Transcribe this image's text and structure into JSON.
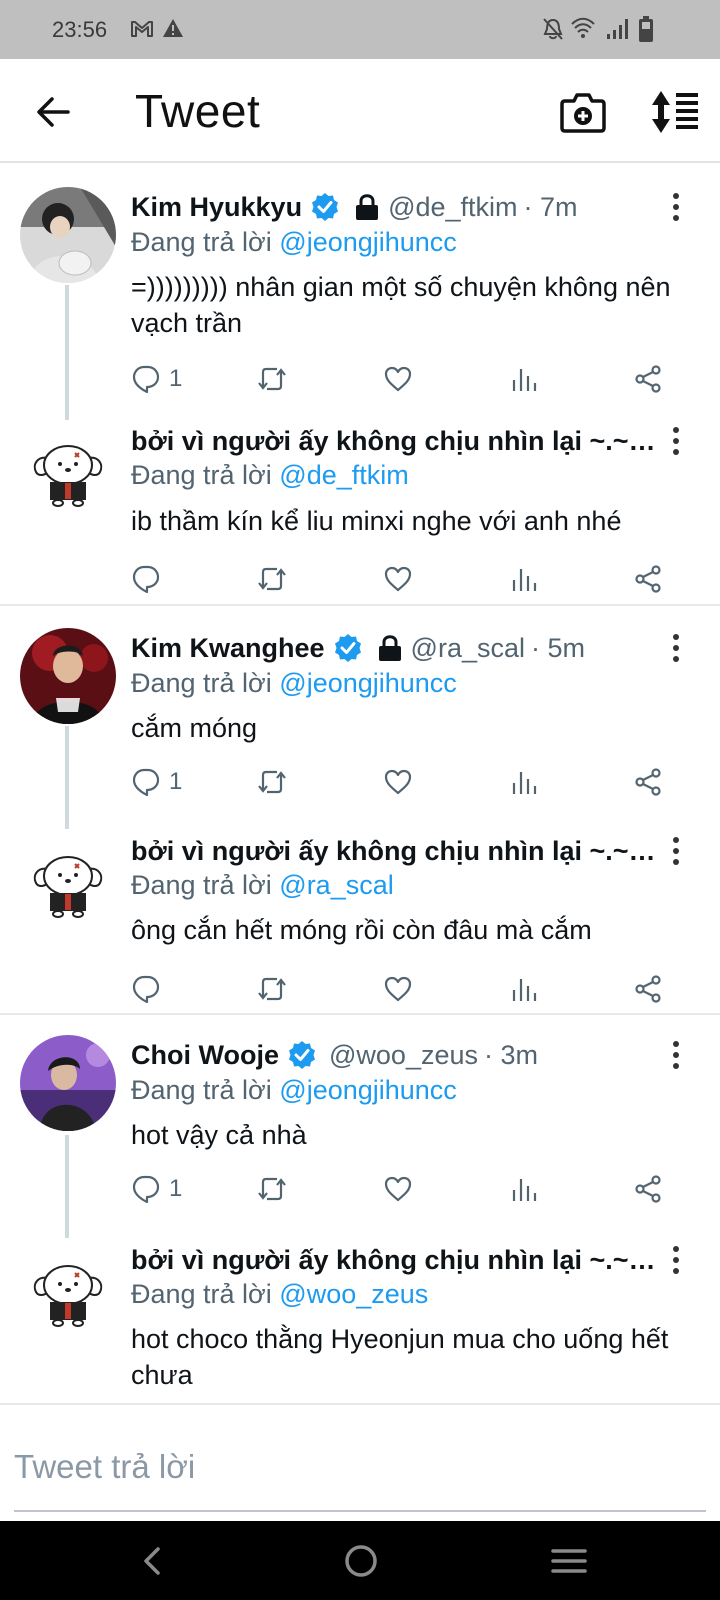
{
  "status_bar": {
    "time": "23:56",
    "left_icons": [
      "gmail-icon",
      "warning-icon"
    ],
    "right_icons": [
      "muted-bell-icon",
      "wifi-icon",
      "signal-icon",
      "battery-icon"
    ]
  },
  "header": {
    "title": "Tweet",
    "icons": [
      "back-arrow-icon",
      "camera-plus-icon",
      "sort-icon"
    ]
  },
  "tweets": [
    {
      "name": "Kim Hyukkyu",
      "verified": true,
      "protected": true,
      "handle": "@de_ftkim",
      "time": "· 7m",
      "reply_prefix": "Đang trả lời",
      "reply_to": "@jeongjihuncc",
      "text": "=))))))))) nhân gian một số chuyện không nên vạch trần",
      "reply_count": "1"
    },
    {
      "name": "bởi vì người ấy không chịu nhìn lại ~.~…",
      "verified": false,
      "protected": false,
      "handle": "",
      "time": "",
      "reply_prefix": "Đang trả lời",
      "reply_to": "@de_ftkim",
      "text": "ib thầm kín kể liu minxi nghe với anh nhé",
      "reply_count": ""
    },
    {
      "name": "Kim Kwanghee",
      "verified": true,
      "protected": true,
      "handle": "@ra_scal",
      "time": "· 5m",
      "reply_prefix": "Đang trả lời",
      "reply_to": "@jeongjihuncc",
      "text": "cắm móng",
      "reply_count": "1"
    },
    {
      "name": "bởi vì người ấy không chịu nhìn lại ~.~…",
      "verified": false,
      "protected": false,
      "handle": "",
      "time": "",
      "reply_prefix": "Đang trả lời",
      "reply_to": "@ra_scal",
      "text": "ông cắn hết móng rồi còn đâu mà cắm",
      "reply_count": ""
    },
    {
      "name": "Choi Wooje",
      "verified": true,
      "protected": false,
      "handle": "@woo_zeus",
      "time": "· 3m",
      "reply_prefix": "Đang trả lời",
      "reply_to": "@jeongjihuncc",
      "text": "hot vậy cả nhà",
      "reply_count": "1"
    },
    {
      "name": "bởi vì người ấy không chịu nhìn lại ~.~…",
      "verified": false,
      "protected": false,
      "handle": "",
      "time": "",
      "reply_prefix": "Đang trả lời",
      "reply_to": "@woo_zeus",
      "text": "hot choco thằng Hyeonjun mua cho uống hết chưa",
      "reply_count": ""
    }
  ],
  "action_icons": [
    "reply-icon",
    "retweet-icon",
    "like-icon",
    "analytics-icon",
    "share-icon"
  ],
  "composer": {
    "placeholder": "Tweet trả lời"
  },
  "nav_bar": {
    "icons": [
      "nav-back-icon",
      "nav-home-icon",
      "nav-recents-icon"
    ]
  },
  "colors": {
    "accent": "#1d9bf0",
    "text": "#0f1419",
    "secondary_text": "#536471",
    "status_bar": "#bfbfbf",
    "nav_bar": "#000000"
  }
}
